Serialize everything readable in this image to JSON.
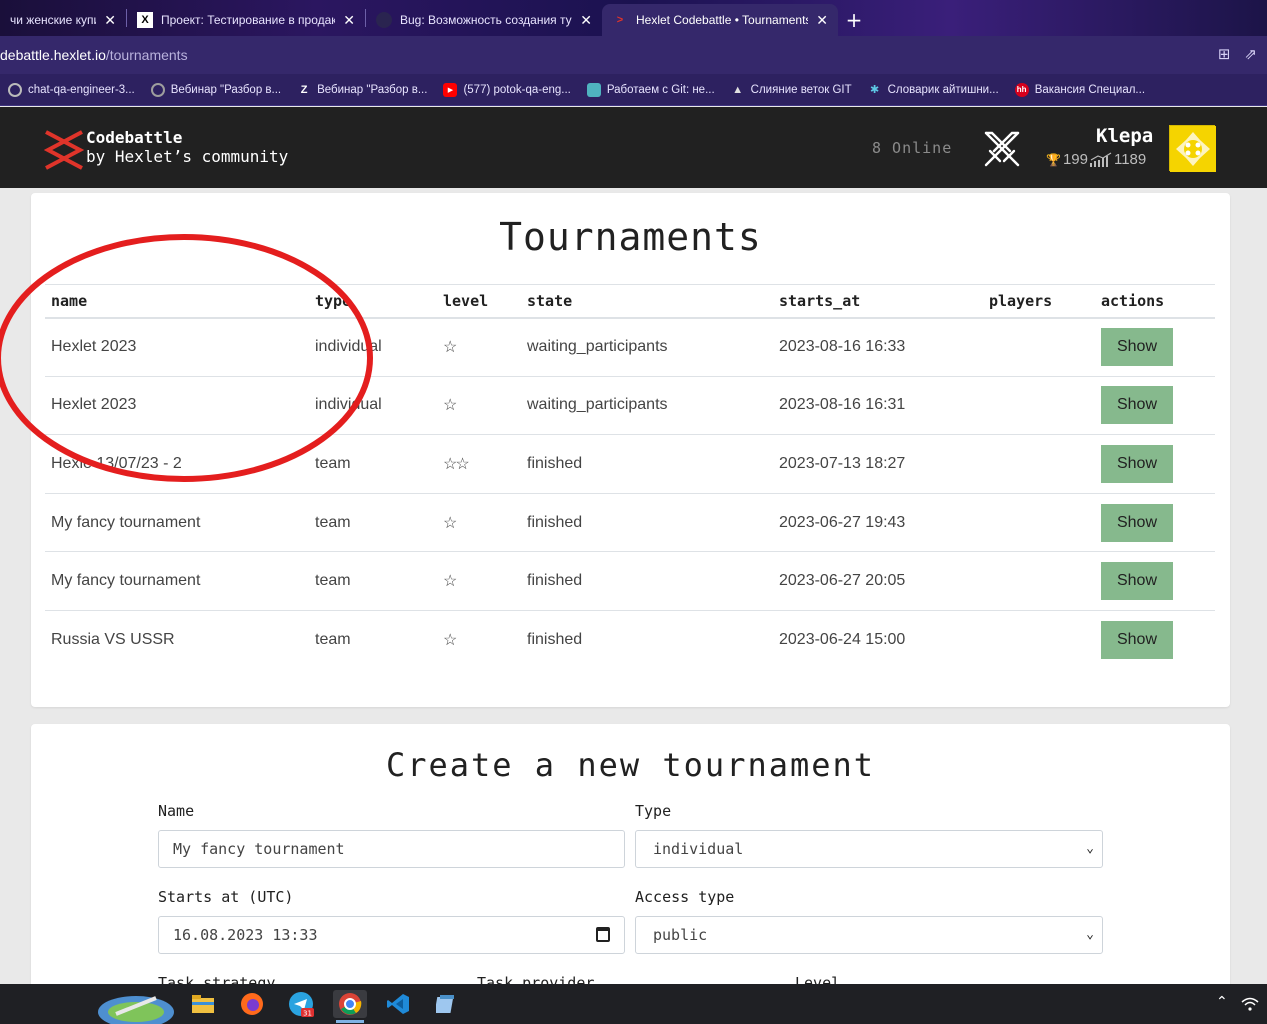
{
  "browser": {
    "tabs": [
      {
        "title": "чи женские купит",
        "active": false
      },
      {
        "title": "Проект: Тестирование в продак",
        "active": false
      },
      {
        "title": "Bug: Возможность создания тур",
        "active": false
      },
      {
        "title": "Hexlet Codebattle • Tournaments",
        "active": true
      }
    ],
    "new_tab_label": "+",
    "close_glyph": "✕",
    "url_host": "debattle.hexlet.io",
    "url_path": "/tournaments",
    "bookmarks": [
      {
        "label": "chat-qa-engineer-3...",
        "icon": "globe-icon",
        "color": "#7a7a7a"
      },
      {
        "label": "Вебинар \"Разбор в...",
        "icon": "globe-icon",
        "color": "#9e9e9e"
      },
      {
        "label": "Вебинар \"Разбор в...",
        "icon": "zoom-icon",
        "color": "#2d8cff"
      },
      {
        "label": "(577) potok-qa-eng...",
        "icon": "youtube-icon",
        "color": "#ff0000"
      },
      {
        "label": "Работаем с Git: не...",
        "icon": "book-icon",
        "color": "#4fb3bf"
      },
      {
        "label": "Слияние веток GIT",
        "icon": "hat-icon",
        "color": "#e0e0e0"
      },
      {
        "label": "Словарик айтишни...",
        "icon": "snow-icon",
        "color": "#5ec8e5"
      },
      {
        "label": "Вакансия Специал...",
        "icon": "hh-icon",
        "color": "#d6001c"
      }
    ]
  },
  "header": {
    "brand_line1": "Codebattle",
    "brand_line2": "by Hexlet’s community",
    "online": "8 Online",
    "user_name": "Klepa",
    "trophies": "199",
    "rating": "1189"
  },
  "tournaments": {
    "title": "Tournaments",
    "columns": [
      "name",
      "type",
      "level",
      "state",
      "starts_at",
      "players",
      "actions"
    ],
    "rows": [
      {
        "name": "Hexlet 2023",
        "type": "individual",
        "stars": "☆",
        "state": "waiting_participants",
        "starts_at": "2023-08-16 16:33",
        "players": "",
        "action": "Show"
      },
      {
        "name": "Hexlet 2023",
        "type": "individual",
        "stars": "☆",
        "state": "waiting_participants",
        "starts_at": "2023-08-16 16:31",
        "players": "",
        "action": "Show"
      },
      {
        "name": "Hexle 13/07/23 - 2",
        "type": "team",
        "stars": "☆☆",
        "state": "finished",
        "starts_at": "2023-07-13 18:27",
        "players": "",
        "action": "Show"
      },
      {
        "name": "My fancy tournament",
        "type": "team",
        "stars": "☆",
        "state": "finished",
        "starts_at": "2023-06-27 19:43",
        "players": "",
        "action": "Show"
      },
      {
        "name": "My fancy tournament",
        "type": "team",
        "stars": "☆",
        "state": "finished",
        "starts_at": "2023-06-27 20:05",
        "players": "",
        "action": "Show"
      },
      {
        "name": "Russia VS USSR",
        "type": "team",
        "stars": "☆",
        "state": "finished",
        "starts_at": "2023-06-24 15:00",
        "players": "",
        "action": "Show"
      }
    ]
  },
  "create": {
    "title": "Create a new tournament",
    "name_label": "Name",
    "name_value": "My fancy tournament",
    "type_label": "Type",
    "type_value": "individual",
    "starts_label": "Starts at (UTC)",
    "starts_value": "16.08.2023 13:33",
    "access_label": "Access type",
    "access_value": "public",
    "strategy_label": "Task strategy",
    "provider_label": "Task provider",
    "level_label": "Level"
  },
  "colors": {
    "show_button": "#86b98d",
    "annotation": "#e41e1e",
    "header_bg": "#212121"
  },
  "taskbar": {
    "icons": [
      "windows-icon",
      "explorer-icon",
      "firefox-icon",
      "telegram-icon",
      "chrome-icon",
      "vscode-icon",
      "notepad-icon"
    ],
    "telegram_badge": "31"
  }
}
